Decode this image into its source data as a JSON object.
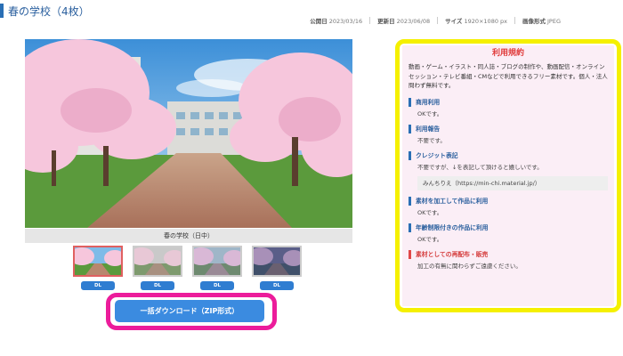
{
  "header": {
    "title": "春の学校（4枚）",
    "meta": [
      {
        "label": "公開日",
        "value": "2023/03/16"
      },
      {
        "label": "更新日",
        "value": "2023/06/08"
      },
      {
        "label": "サイズ",
        "value": "1920×1080 px"
      },
      {
        "label": "画像形式",
        "value": "JPEG"
      }
    ]
  },
  "viewer": {
    "caption": "春の学校（日中）",
    "thumbnails": [
      {
        "dl_label": "DL",
        "variant": "day"
      },
      {
        "dl_label": "DL",
        "variant": "overcast"
      },
      {
        "dl_label": "DL",
        "variant": "evening"
      },
      {
        "dl_label": "DL",
        "variant": "night"
      }
    ],
    "zip_button_label": "一括ダウンロード（ZIP形式）"
  },
  "terms": {
    "title": "利用規約",
    "intro": "動画・ゲーム・イラスト・同人誌・ブログの制作や、動画配信・オンラインセッション・テレビ番組・CMなどで利用できるフリー素材です。個人・法人問わず無料です。",
    "sections": [
      {
        "heading": "商用利用",
        "body": "OKです。"
      },
      {
        "heading": "利用報告",
        "body": "不要です。"
      },
      {
        "heading": "クレジット表記",
        "body": "不要ですが、↓を表記して頂けると嬉しいです。",
        "credit": "みんちりえ（https://min-chi.material.jp/）"
      },
      {
        "heading": "素材を加工して作品に利用",
        "body": "OKです。"
      },
      {
        "heading": "年齢制限付きの作品に利用",
        "body": "OKです。"
      },
      {
        "heading": "素材としての再配布・販売",
        "body": "加工の有無に関わらずご遠慮ください。"
      }
    ]
  },
  "colors": {
    "accent": "#2a6fb5",
    "zip_highlight": "#ec1c9b",
    "terms_highlight": "#f5f000",
    "terms_background": "#fbeef6",
    "warning": "#e04848"
  }
}
